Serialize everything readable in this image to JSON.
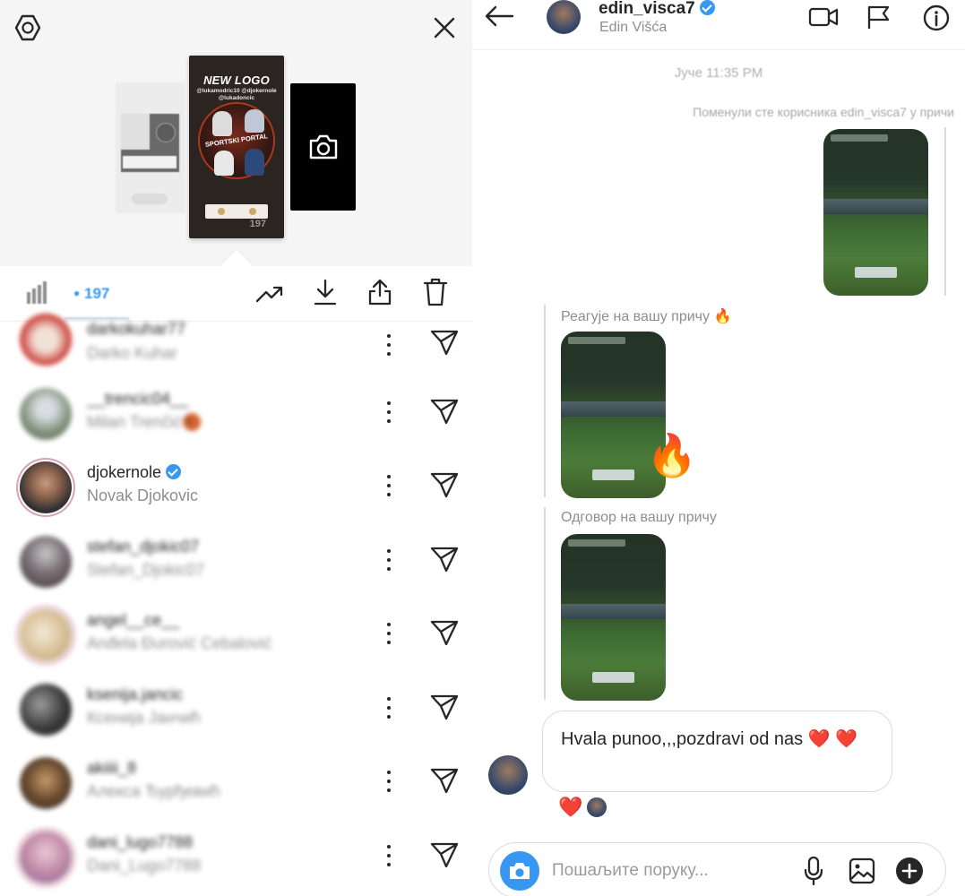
{
  "story_panel": {
    "main_story": {
      "title": "NEW LOGO",
      "mentions": "@lukamodric10 @djokernole @lukadoncic",
      "circle_label": "SPORTSKI PORTAL"
    },
    "viewers_count": "197",
    "viewers_icon": "eye-icon",
    "actions": [
      "insights-icon",
      "download-icon",
      "share-icon",
      "trash-icon"
    ]
  },
  "viewers": [
    {
      "username": "darkokuhar77",
      "full_name": "Darko Kuhar",
      "blurred": true,
      "verified": false
    },
    {
      "username": "__trencic04__",
      "full_name": "Milan Trenčić🏀",
      "blurred": true,
      "verified": false
    },
    {
      "username": "djokernole",
      "full_name": "Novak Djokovic",
      "blurred": false,
      "verified": true
    },
    {
      "username": "stefan_djokic07",
      "full_name": "Stefan_Djokic07",
      "blurred": true,
      "verified": false
    },
    {
      "username": "angel__ce__",
      "full_name": "Anđela Đurović Cebalović",
      "blurred": true,
      "verified": false
    },
    {
      "username": "ksenija.jancic",
      "full_name": "Ксенија Јанчић",
      "blurred": true,
      "verified": false
    },
    {
      "username": "akiiii_8",
      "full_name": "Алекса Ђурђевић",
      "blurred": true,
      "verified": false
    },
    {
      "username": "dani_lugo7788",
      "full_name": "Dani_Lugo7788",
      "blurred": true,
      "verified": false
    }
  ],
  "dm": {
    "username": "edin_visca7",
    "display_name": "Edin Višća",
    "verified": true,
    "timestamp": "Јуче 11:35 PM",
    "mention_label": "Поменули сте корисника edin_visca7 у причи",
    "reaction_label": "Реагује на вашу причу 🔥",
    "reply_label": "Одговор на вашу причу",
    "message": "Hvala punoo,,,pozdravi od nas ❤️ ❤️",
    "reactions": "❤️",
    "composer_placeholder": "Пошаљите поруку..."
  },
  "colors": {
    "accent": "#3897f0",
    "heart": "#e53935",
    "border": "#dbdbdb",
    "muted_text": "#8e8e8e"
  }
}
